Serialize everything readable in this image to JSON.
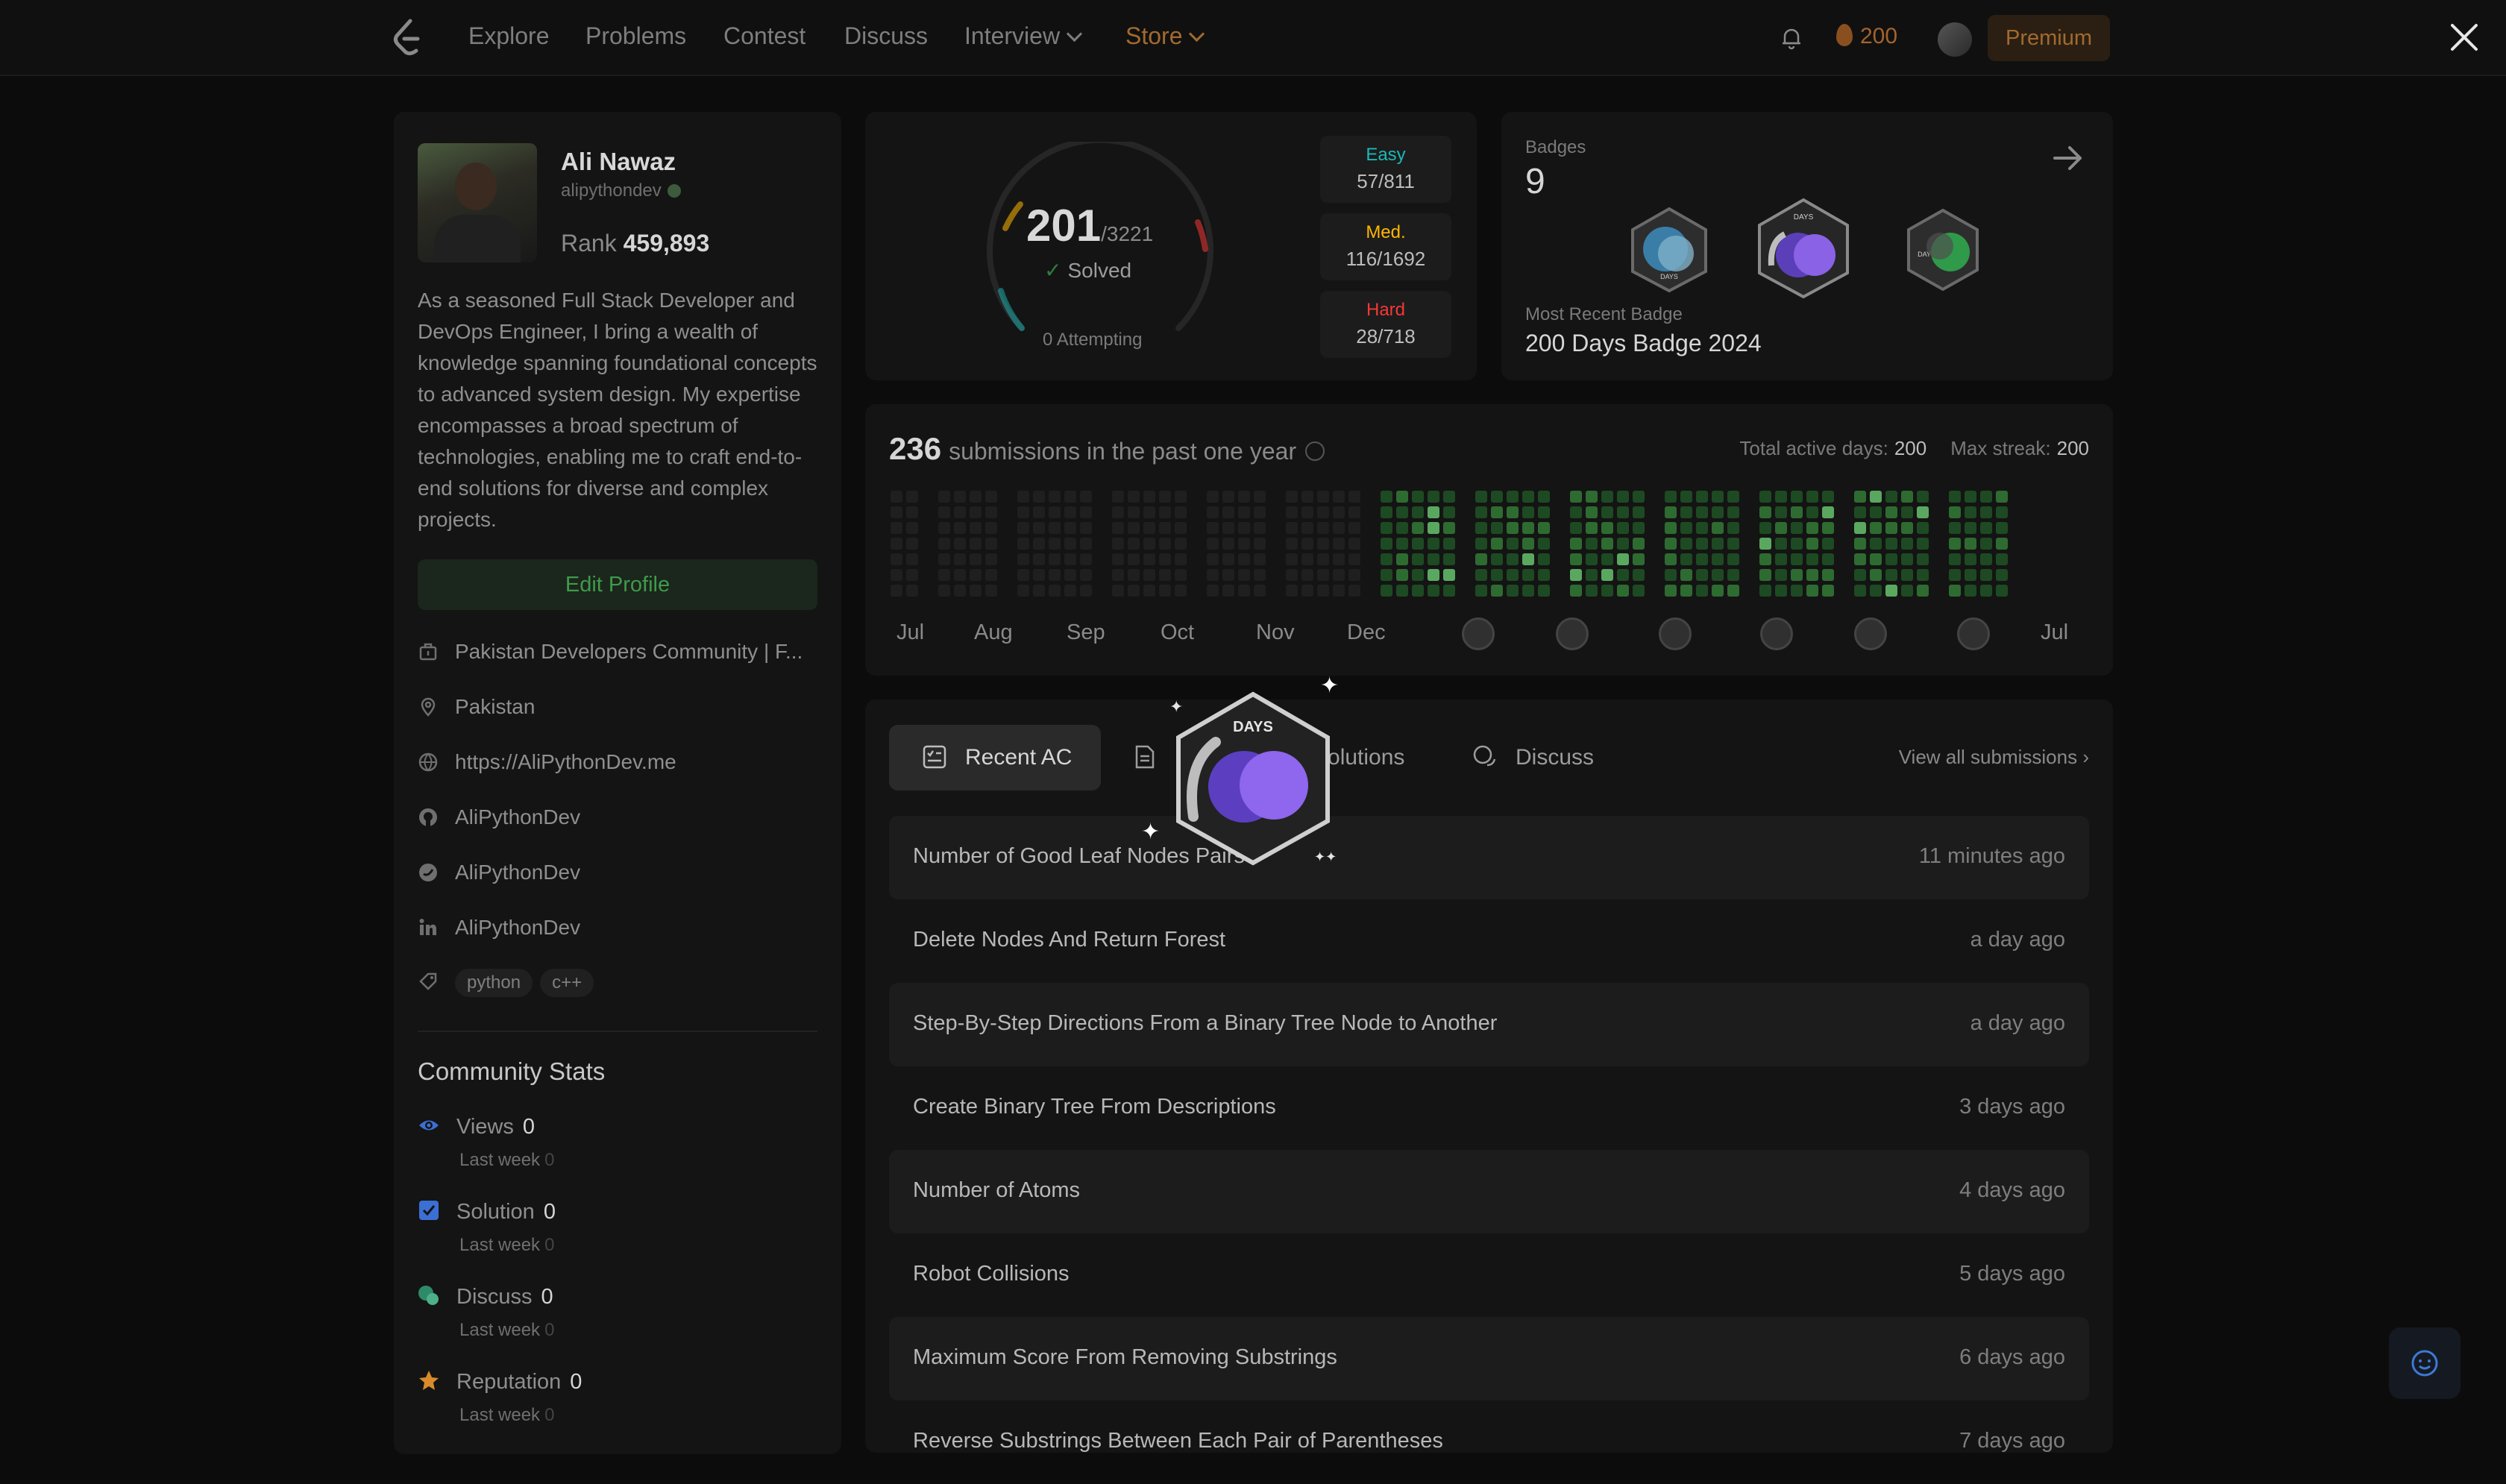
{
  "nav": {
    "items": [
      "Explore",
      "Problems",
      "Contest",
      "Discuss",
      "Interview",
      "Store"
    ],
    "streak_count": "200",
    "premium_label": "Premium"
  },
  "profile": {
    "name": "Ali Nawaz",
    "username": "alipythondev",
    "rank_label": "Rank",
    "rank_value": "459,893",
    "bio": "As a seasoned Full Stack Developer and DevOps Engineer, I bring a wealth of knowledge spanning foundational concepts to advanced system design. My expertise encompasses a broad spectrum of technologies, enabling me to craft end-to-end solutions for diverse and complex projects.",
    "edit_label": "Edit Profile",
    "info": {
      "company": "Pakistan Developers Community | F...",
      "location": "Pakistan",
      "website": "https://AliPythonDev.me",
      "github": "AliPythonDev",
      "twitter": "AliPythonDev",
      "linkedin": "AliPythonDev"
    },
    "tags": [
      "python",
      "c++"
    ]
  },
  "community": {
    "title": "Community Stats",
    "views_label": "Views",
    "views_value": "0",
    "solution_label": "Solution",
    "solution_value": "0",
    "discuss_label": "Discuss",
    "discuss_value": "0",
    "reputation_label": "Reputation",
    "reputation_value": "0",
    "last_week_label": "Last week",
    "last_week_value": "0"
  },
  "solved": {
    "count": "201",
    "total": "/3221",
    "label": "Solved",
    "attempting": "0 Attempting",
    "easy_label": "Easy",
    "easy_value": "57/811",
    "medium_label": "Med.",
    "medium_value": "116/1692",
    "hard_label": "Hard",
    "hard_value": "28/718",
    "colors": {
      "easy": "#1cb8b8",
      "medium": "#ffb700",
      "hard": "#f63737"
    }
  },
  "badges": {
    "label": "Badges",
    "count": "9",
    "recent_label": "Most Recent Badge",
    "recent_name": "200 Days Badge 2024",
    "badge_texts": [
      "DAYS",
      "DAYS",
      "DAYS"
    ]
  },
  "submissions": {
    "count": "236",
    "label": "submissions in the past one year",
    "active_days_label": "Total active days:",
    "active_days_value": "200",
    "max_streak_label": "Max streak:",
    "max_streak_value": "200",
    "months": [
      "Jul",
      "Aug",
      "Sep",
      "Oct",
      "Nov",
      "Dec",
      "Jul"
    ]
  },
  "recent": {
    "tabs": [
      "Recent AC",
      "List",
      "Solutions",
      "Discuss"
    ],
    "view_all": "View all submissions",
    "badge_overlay_text": "DAYS",
    "rows": [
      {
        "title": "Number of Good Leaf Nodes Pairs",
        "time": "11 minutes ago"
      },
      {
        "title": "Delete Nodes And Return Forest",
        "time": "a day ago"
      },
      {
        "title": "Step-By-Step Directions From a Binary Tree Node to Another",
        "time": "a day ago"
      },
      {
        "title": "Create Binary Tree From Descriptions",
        "time": "3 days ago"
      },
      {
        "title": "Number of Atoms",
        "time": "4 days ago"
      },
      {
        "title": "Robot Collisions",
        "time": "5 days ago"
      },
      {
        "title": "Maximum Score From Removing Substrings",
        "time": "6 days ago"
      },
      {
        "title": "Reverse Substrings Between Each Pair of Parentheses",
        "time": "7 days ago"
      }
    ]
  }
}
